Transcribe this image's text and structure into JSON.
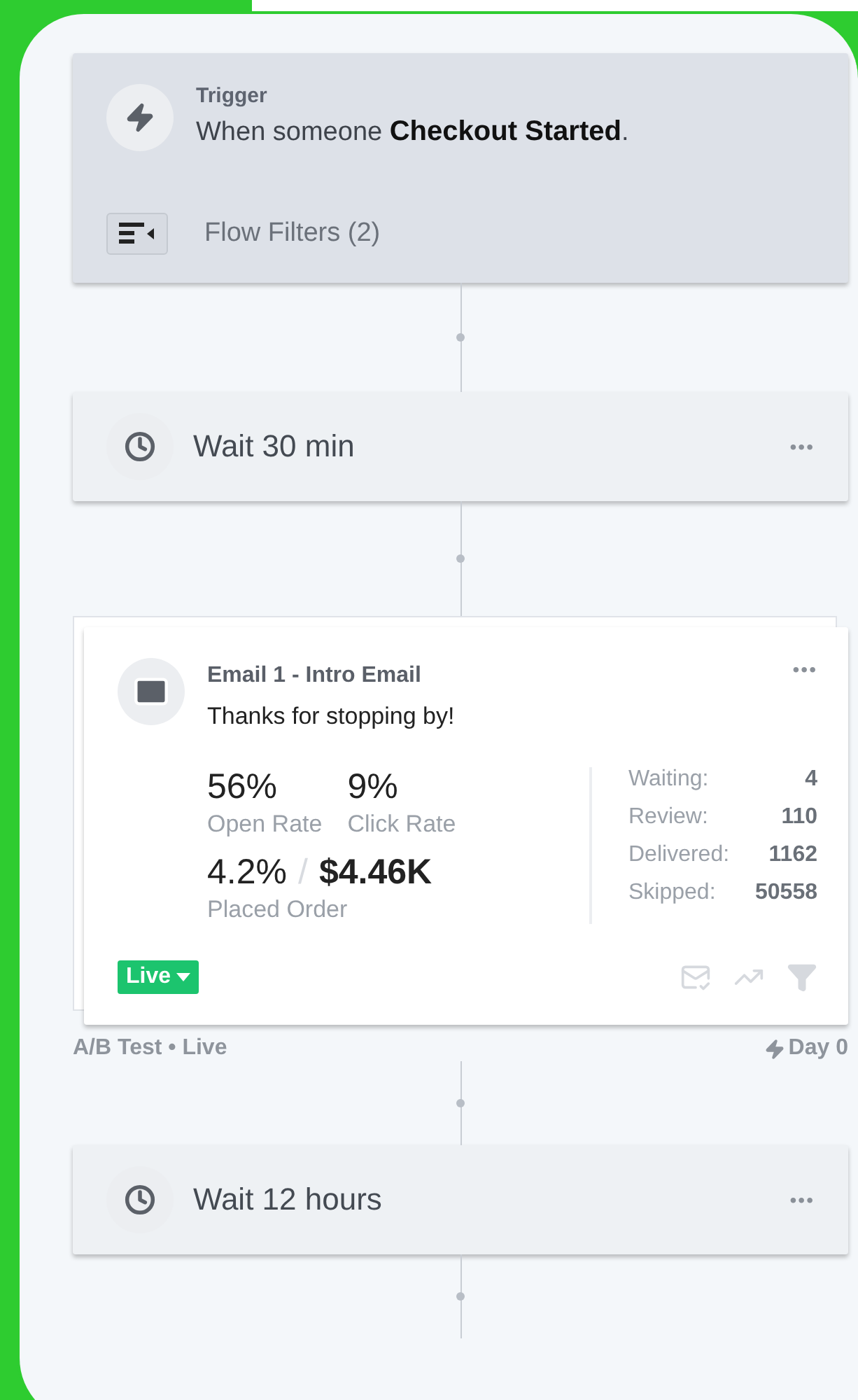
{
  "steps": [
    {
      "kind": "trigger",
      "label": "Trigger",
      "text": "When someone **Checkout Started**.",
      "filters": "Flow Filters (2)"
    },
    {
      "kind": "wait",
      "text": "Wait 30 min",
      "menu": "•••"
    },
    {
      "kind": "email",
      "title": "Email 1 - Intro Email",
      "subject": "Thanks for stopping by!",
      "menu": "•••",
      "rates": [
        {
          "value": "56%",
          "label": "Open Rate"
        },
        {
          "value": "9%",
          "label": "Click Rate"
        }
      ],
      "order_value": "4.2%",
      "order_sep": "/",
      "order_revenue": "$4.46K",
      "order_label": "Placed Order",
      "counts": [
        {
          "label": "Waiting:",
          "value": "4"
        },
        {
          "label": "Review:",
          "value": "110"
        },
        {
          "label": "Delivered:",
          "value": "1162"
        },
        {
          "label": "Skipped:",
          "value": "50558"
        }
      ],
      "status": "Live",
      "footer_left": "A/B Test • Live",
      "footer_right": "Day 0"
    },
    {
      "kind": "wait",
      "text": "Wait 12 hours",
      "menu": "•••"
    }
  ]
}
